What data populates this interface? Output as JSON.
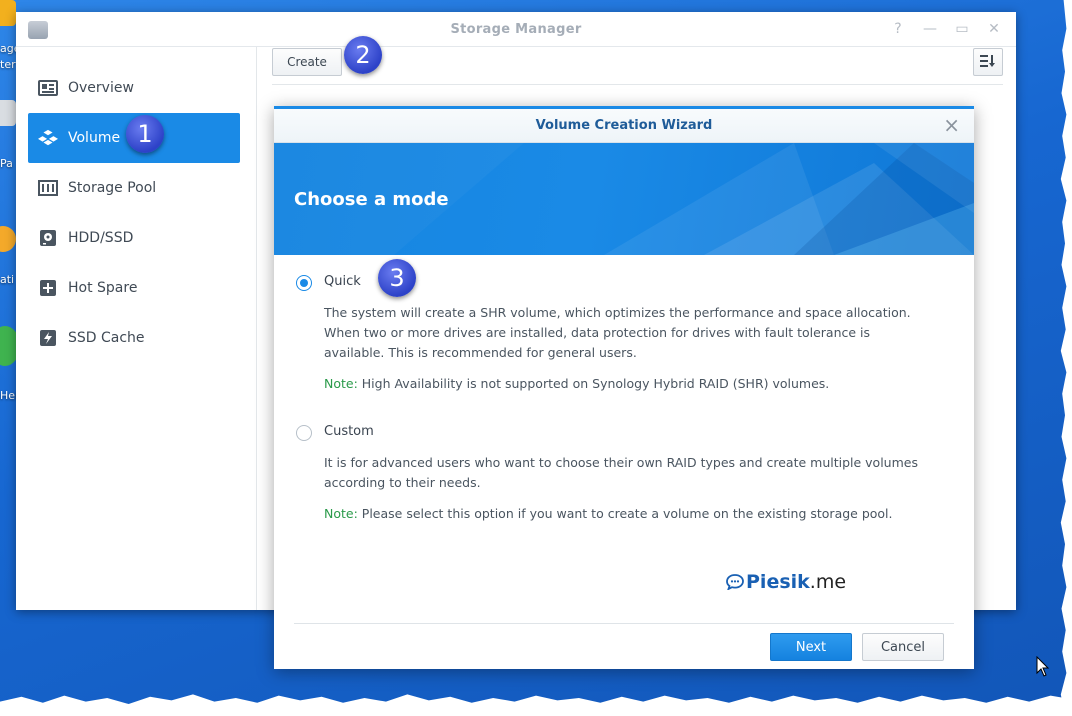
{
  "desktop": {
    "labels": [
      "age",
      "ter",
      "Pa",
      "ati",
      "Hel"
    ]
  },
  "window": {
    "title": "Storage Manager",
    "controls": {
      "help": "?",
      "minimize": "—",
      "maximize": "▭",
      "close": "✕"
    }
  },
  "sidebar": {
    "items": [
      {
        "label": "Overview",
        "icon": "overview-icon"
      },
      {
        "label": "Volume",
        "icon": "volume-icon",
        "active": true
      },
      {
        "label": "Storage Pool",
        "icon": "storage-pool-icon"
      },
      {
        "label": "HDD/SSD",
        "icon": "hdd-icon"
      },
      {
        "label": "Hot Spare",
        "icon": "hot-spare-icon"
      },
      {
        "label": "SSD Cache",
        "icon": "ssd-cache-icon"
      }
    ]
  },
  "toolbar": {
    "create_label": "Create",
    "sort_icon": "sort-icon"
  },
  "wizard": {
    "title": "Volume Creation Wizard",
    "heading": "Choose a mode",
    "options": [
      {
        "label": "Quick",
        "checked": true,
        "description": "The system will create a SHR volume, which optimizes the performance and space allocation. When two or more drives are installed, data protection for drives with fault tolerance is available. This is recommended for general users.",
        "note_key": "Note:",
        "note_text": " High Availability is not supported on Synology Hybrid RAID (SHR) volumes."
      },
      {
        "label": "Custom",
        "checked": false,
        "description": "It is for advanced users who want to choose their own RAID types and create multiple volumes according to their needs.",
        "note_key": "Note:",
        "note_text": " Please select this option if you want to create a volume on the existing storage pool."
      }
    ],
    "next_label": "Next",
    "cancel_label": "Cancel"
  },
  "watermark": {
    "brand": "Piesik",
    "suffix": ".me"
  },
  "steps": [
    "1",
    "2",
    "3"
  ],
  "colors": {
    "accent": "#1a8ae6",
    "note": "#2a9a4a",
    "step_badge": "#2d42c8"
  }
}
